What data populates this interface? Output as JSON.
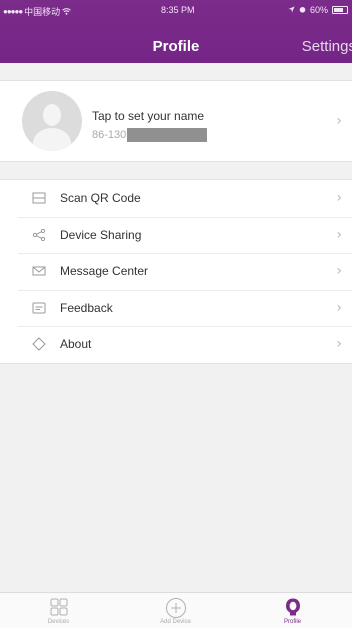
{
  "status_bar": {
    "signal_dots": "●●●●●",
    "carrier": "中国移动",
    "wifi_icon": "wifi-icon",
    "time": "8:35 PM",
    "battery_percent": "60%"
  },
  "header": {
    "title": "Profile",
    "settings_label": "Settings",
    "background_color": "#7b2c8b"
  },
  "profile": {
    "name_prompt": "Tap to set your name",
    "phone_prefix": "86-130"
  },
  "menu": {
    "items": [
      {
        "label": "Scan QR Code",
        "icon": "qr-scan-icon"
      },
      {
        "label": "Device Sharing",
        "icon": "share-icon"
      },
      {
        "label": "Message Center",
        "icon": "mail-icon"
      },
      {
        "label": "Feedback",
        "icon": "feedback-icon"
      },
      {
        "label": "About",
        "icon": "diamond-icon"
      }
    ],
    "chevron": "›"
  },
  "tabbar": {
    "tabs": [
      {
        "label": "Devices",
        "icon": "grid-icon"
      },
      {
        "label": "Add Device",
        "icon": "plus-circle-icon"
      },
      {
        "label": "Profile",
        "icon": "user-icon",
        "active": true
      }
    ],
    "active_color": "#7b2c8b"
  }
}
